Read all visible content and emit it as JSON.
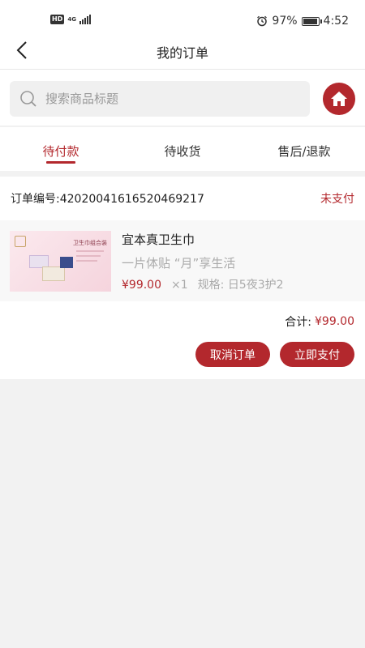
{
  "status_bar": {
    "hd": "HD",
    "network": "4G",
    "battery_percent": "97%",
    "time": "4:52"
  },
  "nav": {
    "title": "我的订单"
  },
  "search": {
    "placeholder": "搜索商品标题"
  },
  "tabs": [
    {
      "label": "待付款",
      "active": true
    },
    {
      "label": "待收货",
      "active": false
    },
    {
      "label": "售后/退款",
      "active": false
    }
  ],
  "order": {
    "id_label": "订单编号:",
    "id_value": "42020041616520469217",
    "status": "未支付",
    "item": {
      "title": "宜本真卫生巾",
      "subtitle": "一片体贴 “月”享生活",
      "price": "¥99.00",
      "qty": "×1",
      "spec_label": "规格:",
      "spec_value": "日5夜3护2",
      "image_text": "卫生巾组合装"
    },
    "total_label": "合计:",
    "total_value": "¥99.00",
    "actions": {
      "cancel": "取消订单",
      "pay": "立即支付"
    }
  },
  "colors": {
    "accent": "#b3282d",
    "background": "#f2f2f2"
  }
}
